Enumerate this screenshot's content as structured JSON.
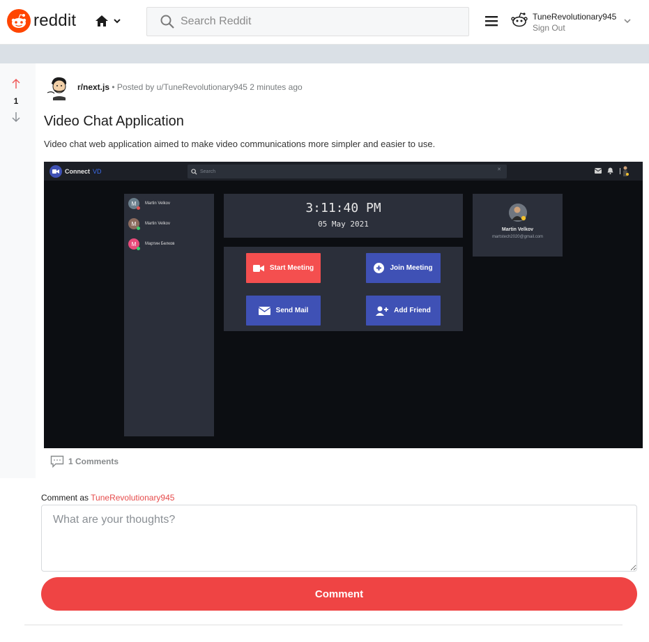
{
  "header": {
    "logo_text": "reddit",
    "search_placeholder": "Search Reddit",
    "username": "TuneRevolutionary945",
    "signout_label": "Sign Out"
  },
  "post": {
    "score": "1",
    "subreddit": "r/next.js",
    "posted_by_prefix": "• Posted by",
    "author": "u/TuneRevolutionary945",
    "time_ago": "2 minutes ago",
    "title": "Video Chat Application",
    "description": "Video chat web application aimed to make video communications more simpler and easier to use.",
    "comments_label": "1 Comments"
  },
  "embedded_app": {
    "brand": "Connect",
    "brand_suffix": "VD",
    "search_placeholder": "Search",
    "contacts": [
      {
        "initial": "M",
        "name": "Martin Velkov",
        "color": "#6b7f8c",
        "status": "#e05555"
      },
      {
        "initial": "M",
        "name": "Martin Velkov",
        "color": "#8c6b5e",
        "status": "#3ccf70"
      },
      {
        "initial": "M",
        "name": "Мартин Белков",
        "color": "#e84a7a",
        "status": "#3ccf70"
      }
    ],
    "time": "3:11:40 PM",
    "date": "05 May 2021",
    "buttons": {
      "start_meeting": "Start Meeting",
      "join_meeting": "Join Meeting",
      "send_mail": "Send Mail",
      "add_friend": "Add Friend"
    },
    "profile_name": "Martin Velkov",
    "profile_email": "martstech2020@gmail.com",
    "colors": {
      "red_button": "#f44f4f",
      "blue_button": "#3f51b5"
    }
  },
  "comment_form": {
    "comment_as": "Comment as",
    "username": "TuneRevolutionary945",
    "placeholder": "What are your thoughts?",
    "submit_label": "Comment"
  },
  "colors": {
    "accent": "#ff4500",
    "button": "#ef4444"
  }
}
